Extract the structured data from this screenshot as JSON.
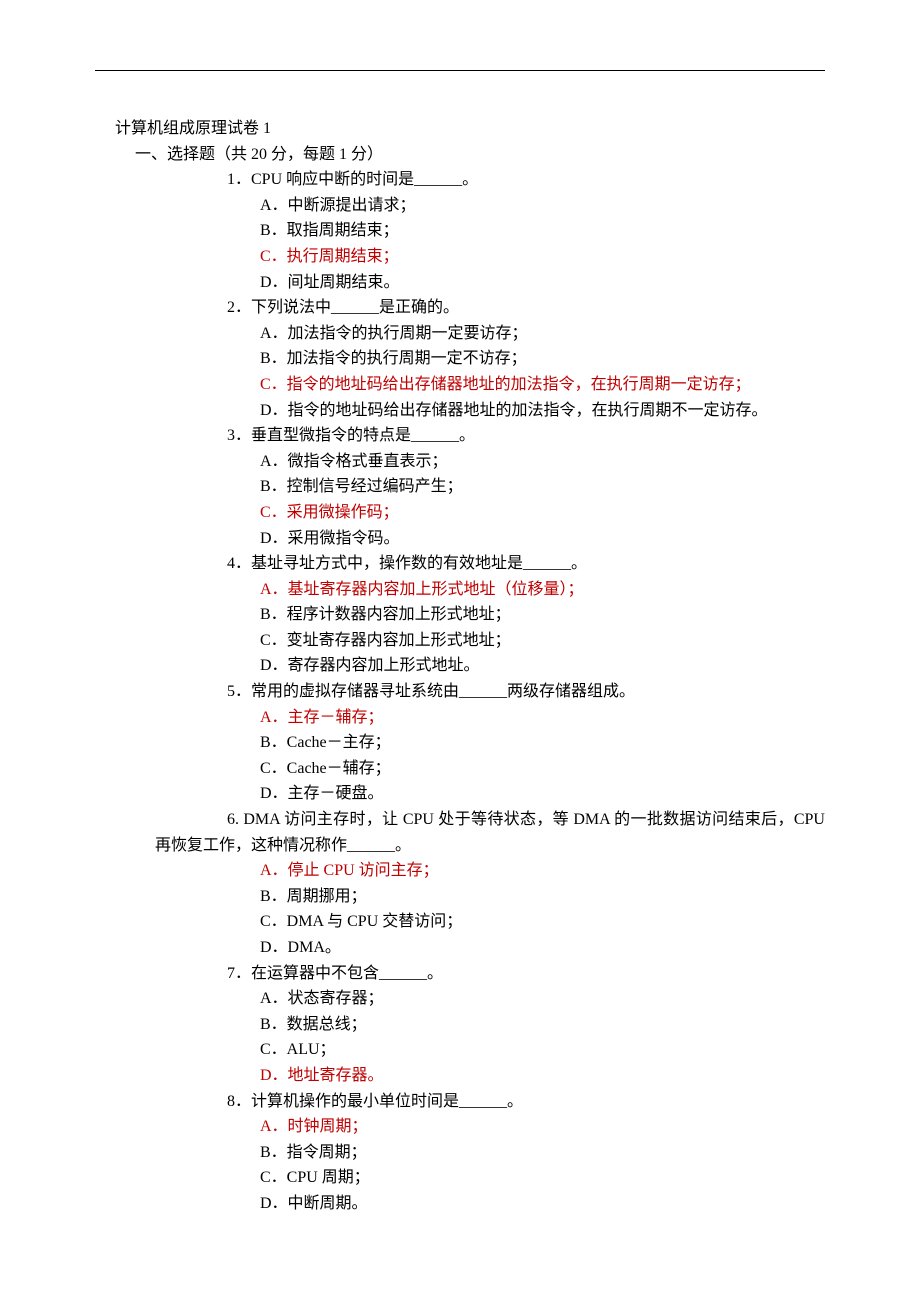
{
  "title": "计算机组成原理试卷 1",
  "section_header": "一、选择题（共 20 分，每题 1 分）",
  "questions": [
    {
      "num": "1．",
      "stem": "CPU 响应中断的时间是______。",
      "options": [
        {
          "label": "A．",
          "text": "中断源提出请求；",
          "answer": false
        },
        {
          "label": "B．",
          "text": "取指周期结束；",
          "answer": false
        },
        {
          "label": "C．",
          "text": "执行周期结束；",
          "answer": true
        },
        {
          "label": "D．",
          "text": "间址周期结束。",
          "answer": false
        }
      ]
    },
    {
      "num": "2．",
      "stem": "下列说法中______是正确的。",
      "options": [
        {
          "label": "A．",
          "text": "加法指令的执行周期一定要访存；",
          "answer": false
        },
        {
          "label": "B．",
          "text": "加法指令的执行周期一定不访存；",
          "answer": false
        },
        {
          "label": "C．",
          "text": "指令的地址码给出存储器地址的加法指令，在执行周期一定访存；",
          "answer": true
        },
        {
          "label": "D．",
          "text": "指令的地址码给出存储器地址的加法指令，在执行周期不一定访存。",
          "answer": false
        }
      ]
    },
    {
      "num": "3．",
      "stem": "垂直型微指令的特点是______。",
      "options": [
        {
          "label": "A．",
          "text": "微指令格式垂直表示；",
          "answer": false
        },
        {
          "label": "B．",
          "text": "控制信号经过编码产生；",
          "answer": false
        },
        {
          "label": "C．",
          "text": "采用微操作码；",
          "answer": true
        },
        {
          "label": "D．",
          "text": "采用微指令码。",
          "answer": false
        }
      ]
    },
    {
      "num": "4．",
      "stem": "基址寻址方式中，操作数的有效地址是______。",
      "options": [
        {
          "label": "A．",
          "text": "基址寄存器内容加上形式地址（位移量）；",
          "answer": true
        },
        {
          "label": "B．",
          "text": "程序计数器内容加上形式地址；",
          "answer": false
        },
        {
          "label": "C．",
          "text": "变址寄存器内容加上形式地址；",
          "answer": false
        },
        {
          "label": "D．",
          "text": "寄存器内容加上形式地址。",
          "answer": false
        }
      ]
    },
    {
      "num": "5．",
      "stem": "常用的虚拟存储器寻址系统由______两级存储器组成。",
      "options": [
        {
          "label": "A．",
          "text": "主存－辅存；",
          "answer": true
        },
        {
          "label": "B．",
          "text": "Cache－主存；",
          "answer": false
        },
        {
          "label": "C．",
          "text": "Cache－辅存；",
          "answer": false
        },
        {
          "label": "D．",
          "text": "主存－硬盘。",
          "answer": false
        }
      ]
    },
    {
      "num": "6.",
      "stem_wrap": "DMA 访问主存时，让 CPU 处于等待状态，等 DMA 的一批数据访问结束后，CPU再恢复工作，这种情况称作______。",
      "options": [
        {
          "label": "A．",
          "text": "停止 CPU 访问主存；",
          "answer": true
        },
        {
          "label": "B．",
          "text": "周期挪用；",
          "answer": false
        },
        {
          "label": "C．",
          "text": "DMA 与 CPU 交替访问；",
          "answer": false
        },
        {
          "label": "D．",
          "text": "DMA。",
          "answer": false
        }
      ]
    },
    {
      "num": "7．",
      "stem": "在运算器中不包含______。",
      "options": [
        {
          "label": "A．",
          "text": "状态寄存器；",
          "answer": false
        },
        {
          "label": "B．",
          "text": "数据总线；",
          "answer": false
        },
        {
          "label": "C．",
          "text": "ALU；",
          "answer": false
        },
        {
          "label": "D．",
          "text": "地址寄存器。",
          "answer": true
        }
      ]
    },
    {
      "num": "8．",
      "stem": "计算机操作的最小单位时间是______。",
      "options": [
        {
          "label": "A．",
          "text": "时钟周期；",
          "answer": true
        },
        {
          "label": "B．",
          "text": "指令周期；",
          "answer": false
        },
        {
          "label": "C．",
          "text": "CPU 周期；",
          "answer": false
        },
        {
          "label": "D．",
          "text": "中断周期。",
          "answer": false
        }
      ]
    }
  ]
}
